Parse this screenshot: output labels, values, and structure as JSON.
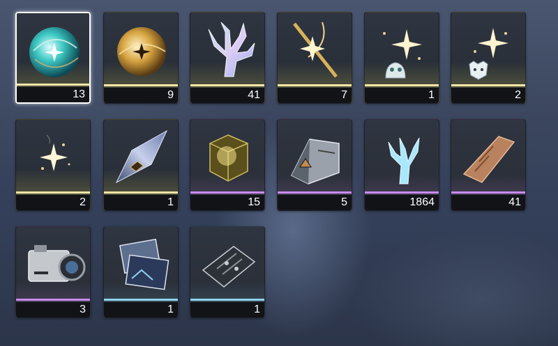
{
  "colors": {
    "rarity_gold": "#f2e6a6",
    "rarity_purple": "#c98bf0",
    "rarity_blue": "#8fd3f0"
  },
  "selected_index": 0,
  "items": [
    {
      "icon": "teal-orb-icon",
      "count": "13",
      "rarity": "gold"
    },
    {
      "icon": "golden-orb-icon",
      "count": "9",
      "rarity": "gold"
    },
    {
      "icon": "crystal-coral-icon",
      "count": "41",
      "rarity": "gold"
    },
    {
      "icon": "star-blade-icon",
      "count": "7",
      "rarity": "gold"
    },
    {
      "icon": "sparkle-helmet-icon",
      "count": "1",
      "rarity": "gold"
    },
    {
      "icon": "sparkle-wolf-icon",
      "count": "2",
      "rarity": "gold"
    },
    {
      "icon": "sparkle-dust-icon",
      "count": "2",
      "rarity": "gold"
    },
    {
      "icon": "crystal-shard-icon",
      "count": "1",
      "rarity": "gold"
    },
    {
      "icon": "golden-cube-icon",
      "count": "15",
      "rarity": "purple"
    },
    {
      "icon": "metal-prism-icon",
      "count": "5",
      "rarity": "purple"
    },
    {
      "icon": "blue-coral-icon",
      "count": "1864",
      "rarity": "purple"
    },
    {
      "icon": "copper-plate-icon",
      "count": "41",
      "rarity": "purple"
    },
    {
      "icon": "camera-icon",
      "count": "3",
      "rarity": "purple"
    },
    {
      "icon": "photo-cards-icon",
      "count": "1",
      "rarity": "blue"
    },
    {
      "icon": "circuit-board-icon",
      "count": "1",
      "rarity": "blue"
    }
  ]
}
